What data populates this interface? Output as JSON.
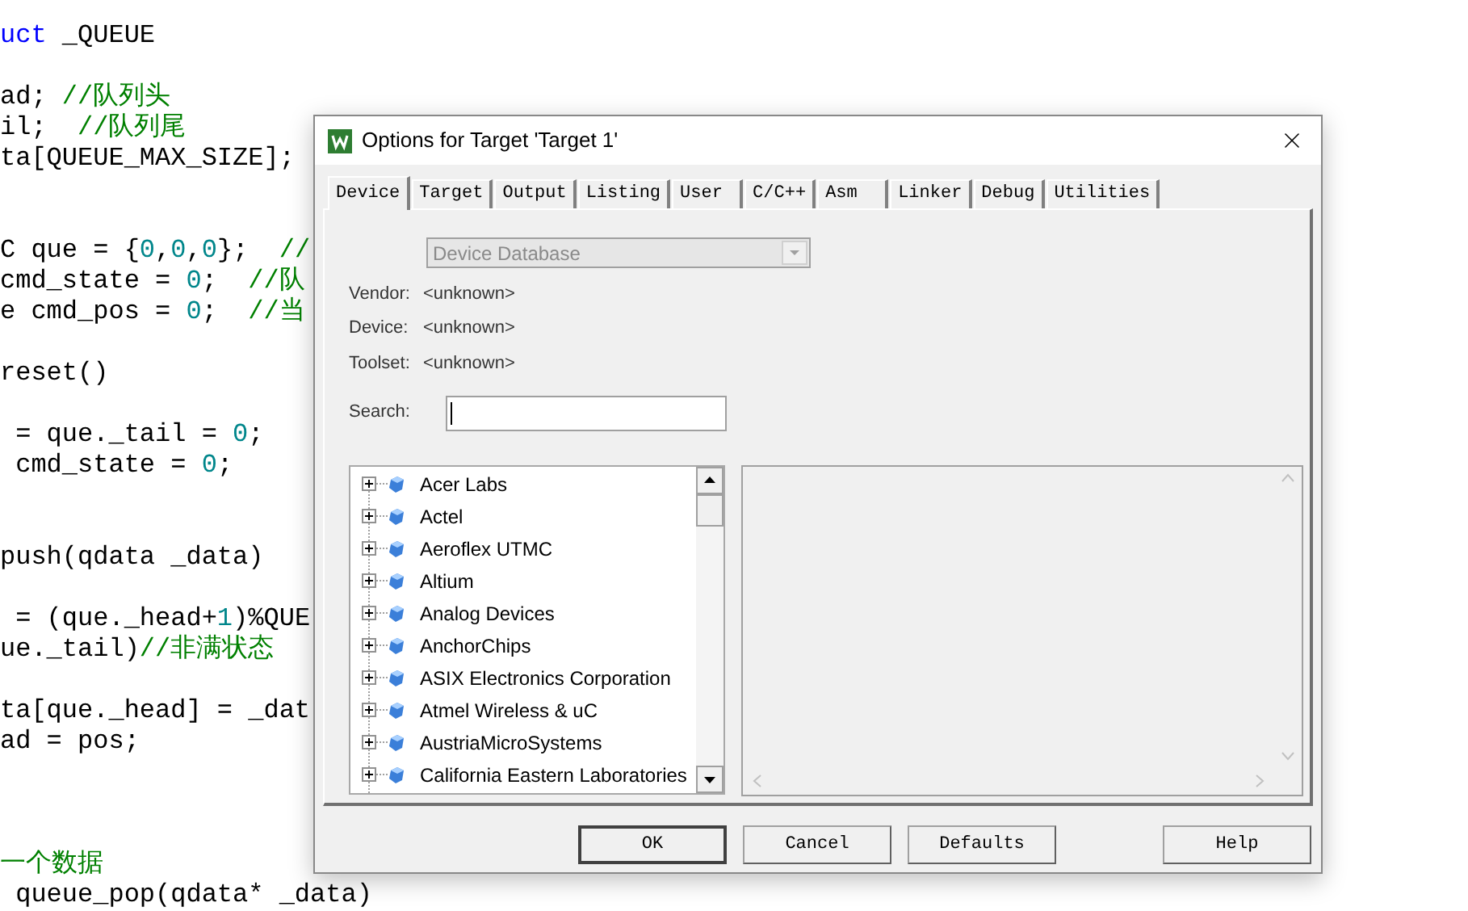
{
  "editor": {
    "lines": [
      {
        "kind": "code",
        "segments": [
          {
            "kind": "keyword",
            "text": "uct"
          },
          {
            "kind": "code",
            "text": " _QUEUE"
          }
        ]
      },
      {
        "kind": "blank"
      },
      {
        "segments": [
          {
            "kind": "code",
            "text": "ad; "
          },
          {
            "kind": "comment",
            "text": "//队列头"
          }
        ]
      },
      {
        "segments": [
          {
            "kind": "code",
            "text": "il;  "
          },
          {
            "kind": "comment",
            "text": "//队列尾"
          }
        ]
      },
      {
        "segments": [
          {
            "kind": "code",
            "text": "ta[QUEUE_MAX_SIZE];"
          }
        ]
      },
      {
        "kind": "blank"
      },
      {
        "kind": "blank"
      },
      {
        "segments": [
          {
            "kind": "code",
            "text": "C que = {"
          },
          {
            "kind": "number",
            "text": "0"
          },
          {
            "kind": "code",
            "text": ","
          },
          {
            "kind": "number",
            "text": "0"
          },
          {
            "kind": "code",
            "text": ","
          },
          {
            "kind": "number",
            "text": "0"
          },
          {
            "kind": "code",
            "text": "};  "
          },
          {
            "kind": "comment",
            "text": "//"
          }
        ]
      },
      {
        "segments": [
          {
            "kind": "code",
            "text": "cmd_state = "
          },
          {
            "kind": "number",
            "text": "0"
          },
          {
            "kind": "code",
            "text": ";  "
          },
          {
            "kind": "comment",
            "text": "//队"
          }
        ]
      },
      {
        "segments": [
          {
            "kind": "code",
            "text": "e cmd_pos = "
          },
          {
            "kind": "number",
            "text": "0"
          },
          {
            "kind": "code",
            "text": ";  "
          },
          {
            "kind": "comment",
            "text": "//当"
          }
        ]
      },
      {
        "kind": "blank"
      },
      {
        "segments": [
          {
            "kind": "code",
            "text": "reset()"
          }
        ]
      },
      {
        "kind": "blank"
      },
      {
        "segments": [
          {
            "kind": "code",
            "text": " = que._tail = "
          },
          {
            "kind": "number",
            "text": "0"
          },
          {
            "kind": "code",
            "text": ";"
          }
        ]
      },
      {
        "segments": [
          {
            "kind": "code",
            "text": " cmd_state = "
          },
          {
            "kind": "number",
            "text": "0"
          },
          {
            "kind": "code",
            "text": ";"
          }
        ]
      },
      {
        "kind": "blank"
      },
      {
        "kind": "blank"
      },
      {
        "segments": [
          {
            "kind": "code",
            "text": "push(qdata _data)"
          }
        ]
      },
      {
        "kind": "blank"
      },
      {
        "segments": [
          {
            "kind": "code",
            "text": " = (que._head+"
          },
          {
            "kind": "number",
            "text": "1"
          },
          {
            "kind": "code",
            "text": ")%QUE"
          }
        ]
      },
      {
        "segments": [
          {
            "kind": "code",
            "text": "ue._tail)"
          },
          {
            "kind": "comment",
            "text": "//非满状态"
          }
        ]
      },
      {
        "kind": "blank"
      },
      {
        "segments": [
          {
            "kind": "code",
            "text": "ta[que._head] = _dat"
          }
        ]
      },
      {
        "segments": [
          {
            "kind": "code",
            "text": "ad = pos;"
          }
        ]
      },
      {
        "kind": "blank"
      },
      {
        "kind": "blank"
      },
      {
        "kind": "blank"
      },
      {
        "segments": [
          {
            "kind": "comment",
            "text": "一个数据"
          }
        ]
      },
      {
        "segments": [
          {
            "kind": "code",
            "text": " queue_pop(qdata* _data)"
          }
        ]
      }
    ]
  },
  "dialog": {
    "title": "Options for Target 'Target 1'",
    "tabs": [
      {
        "label": "Device",
        "selected": true
      },
      {
        "label": "Target",
        "selected": false
      },
      {
        "label": "Output",
        "selected": false
      },
      {
        "label": "Listing",
        "selected": false
      },
      {
        "label": "User",
        "selected": false
      },
      {
        "label": "C/C++",
        "selected": false
      },
      {
        "label": "Asm",
        "selected": false
      },
      {
        "label": "Linker",
        "selected": false
      },
      {
        "label": "Debug",
        "selected": false
      },
      {
        "label": "Utilities",
        "selected": false
      }
    ],
    "database_dropdown": {
      "value": "Device Database",
      "disabled": true
    },
    "fields": [
      {
        "label": "Vendor:",
        "value": "<unknown>"
      },
      {
        "label": "Device:",
        "value": "<unknown>"
      },
      {
        "label": "Toolset:",
        "value": "<unknown>"
      }
    ],
    "search": {
      "label": "Search:",
      "focused": true
    },
    "device_tree": [
      {
        "label": "Acer Labs",
        "expanded": false
      },
      {
        "label": "Actel",
        "expanded": false
      },
      {
        "label": "Aeroflex UTMC",
        "expanded": false
      },
      {
        "label": "Altium",
        "expanded": false
      },
      {
        "label": "Analog Devices",
        "expanded": false
      },
      {
        "label": "AnchorChips",
        "expanded": false
      },
      {
        "label": "ASIX Electronics Corporation",
        "expanded": false
      },
      {
        "label": "Atmel Wireless & uC",
        "expanded": false
      },
      {
        "label": "AustriaMicroSystems",
        "expanded": false
      },
      {
        "label": "California Eastern Laboratories",
        "expanded": false
      }
    ],
    "buttons": [
      {
        "label": "OK",
        "kind": "default"
      },
      {
        "label": "Cancel",
        "kind": "normal"
      },
      {
        "label": "Defaults",
        "kind": "normal"
      },
      {
        "label": "Help",
        "kind": "help"
      }
    ]
  }
}
